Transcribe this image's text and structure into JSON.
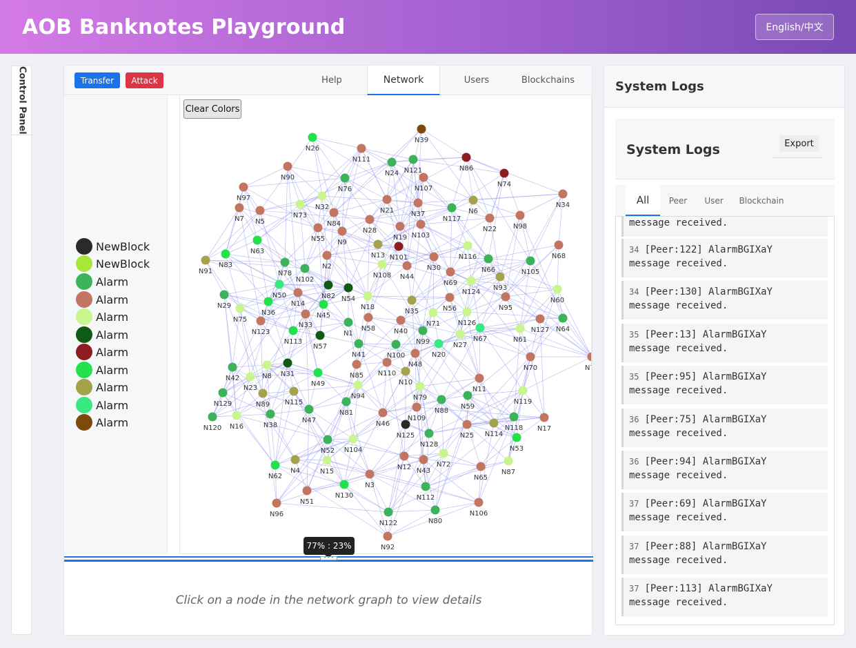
{
  "header": {
    "title": "AOB Banknotes Playground",
    "language_button": "English/中文"
  },
  "side_panel": {
    "label": "Control Panel"
  },
  "toolbar": {
    "transfer_label": "Transfer",
    "attack_label": "Attack"
  },
  "tabs": [
    "Help",
    "Network",
    "Users",
    "Blockchains"
  ],
  "active_tab": "Network",
  "graph": {
    "clear_colors_label": "Clear Colors"
  },
  "legend": [
    {
      "label": "NewBlock",
      "color": "#2a2a2a"
    },
    {
      "label": "NewBlock",
      "color": "#a8e63c"
    },
    {
      "label": "Alarm",
      "color": "#3cb35a"
    },
    {
      "label": "Alarm",
      "color": "#c27560"
    },
    {
      "label": "Alarm",
      "color": "#c8f58c"
    },
    {
      "label": "Alarm",
      "color": "#0f5a14"
    },
    {
      "label": "Alarm",
      "color": "#8e1d22"
    },
    {
      "label": "Alarm",
      "color": "#22e14a"
    },
    {
      "label": "Alarm",
      "color": "#a4a24a"
    },
    {
      "label": "Alarm",
      "color": "#38e883"
    },
    {
      "label": "Alarm",
      "color": "#7b4a0c"
    }
  ],
  "splitter": {
    "ratio": "77% : 23%"
  },
  "details": {
    "hint": "Click on a node in the network graph to view details"
  },
  "logs": {
    "card_title": "System Logs",
    "inner_title": "System Logs",
    "export_label": "Export",
    "tabs": [
      "All",
      "Peer",
      "User",
      "Blockchain"
    ],
    "active_tab": "All",
    "partial_entry": "message received.",
    "entries": [
      {
        "time": "34",
        "text": "[Peer:122] AlarmBGIXaY",
        "text2": "message received."
      },
      {
        "time": "34",
        "text": "[Peer:130] AlarmBGIXaY",
        "text2": "message received."
      },
      {
        "time": "35",
        "text": "[Peer:13] AlarmBGIXaY",
        "text2": "message received."
      },
      {
        "time": "35",
        "text": "[Peer:95] AlarmBGIXaY",
        "text2": "message received."
      },
      {
        "time": "36",
        "text": "[Peer:75] AlarmBGIXaY",
        "text2": "message received."
      },
      {
        "time": "36",
        "text": "[Peer:94] AlarmBGIXaY",
        "text2": "message received."
      },
      {
        "time": "37",
        "text": "[Peer:69] AlarmBGIXaY",
        "text2": "message received."
      },
      {
        "time": "37",
        "text": "[Peer:88] AlarmBGIXaY",
        "text2": "message received."
      },
      {
        "time": "37",
        "text": "[Peer:113] AlarmBGIXaY",
        "text2": "message received."
      }
    ]
  },
  "network_nodes": [
    {
      "label": "N39",
      "color": "#7b4a0c"
    },
    {
      "label": "N26",
      "color": "#22e14a"
    },
    {
      "label": "N111",
      "color": "#c27560"
    },
    {
      "label": "N86",
      "color": "#8e1d22"
    },
    {
      "label": "N24",
      "color": "#3cb35a"
    },
    {
      "label": "N121",
      "color": "#3cb35a"
    },
    {
      "label": "N90",
      "color": "#c27560"
    },
    {
      "label": "N76",
      "color": "#3cb35a"
    },
    {
      "label": "N107",
      "color": "#c27560"
    },
    {
      "label": "N74",
      "color": "#8e1d22"
    },
    {
      "label": "N97",
      "color": "#c27560"
    },
    {
      "label": "N34",
      "color": "#c27560"
    },
    {
      "label": "N7",
      "color": "#c27560"
    },
    {
      "label": "N5",
      "color": "#c27560"
    },
    {
      "label": "N73",
      "color": "#c8f58c"
    },
    {
      "label": "N32",
      "color": "#c8f58c"
    },
    {
      "label": "N84",
      "color": "#c27560"
    },
    {
      "label": "N21",
      "color": "#c27560"
    },
    {
      "label": "N37",
      "color": "#c27560"
    },
    {
      "label": "N117",
      "color": "#3cb35a"
    },
    {
      "label": "N6",
      "color": "#a4a24a"
    },
    {
      "label": "N22",
      "color": "#c27560"
    },
    {
      "label": "N98",
      "color": "#c27560"
    },
    {
      "label": "N55",
      "color": "#c27560"
    },
    {
      "label": "N28",
      "color": "#c27560"
    },
    {
      "label": "N9",
      "color": "#c27560"
    },
    {
      "label": "N19",
      "color": "#c27560"
    },
    {
      "label": "N103",
      "color": "#c27560"
    },
    {
      "label": "N63",
      "color": "#22e14a"
    },
    {
      "label": "N83",
      "color": "#22e14a"
    },
    {
      "label": "N13",
      "color": "#a4a24a"
    },
    {
      "label": "N101",
      "color": "#8e1d22"
    },
    {
      "label": "N116",
      "color": "#c8f58c"
    },
    {
      "label": "N68",
      "color": "#c27560"
    },
    {
      "label": "N91",
      "color": "#a4a24a"
    },
    {
      "label": "N78",
      "color": "#3cb35a"
    },
    {
      "label": "N102",
      "color": "#3cb35a"
    },
    {
      "label": "N2",
      "color": "#c27560"
    },
    {
      "label": "N108",
      "color": "#c8f58c"
    },
    {
      "label": "N44",
      "color": "#c27560"
    },
    {
      "label": "N30",
      "color": "#c27560"
    },
    {
      "label": "N66",
      "color": "#3cb35a"
    },
    {
      "label": "N105",
      "color": "#3cb35a"
    },
    {
      "label": "N69",
      "color": "#c27560"
    },
    {
      "label": "N93",
      "color": "#a4a24a"
    },
    {
      "label": "N50",
      "color": "#38e883"
    },
    {
      "label": "N82",
      "color": "#0f5a14"
    },
    {
      "label": "N54",
      "color": "#0f5a14"
    },
    {
      "label": "N124",
      "color": "#c8f58c"
    },
    {
      "label": "N29",
      "color": "#3cb35a"
    },
    {
      "label": "N14",
      "color": "#c27560"
    },
    {
      "label": "N18",
      "color": "#c8f58c"
    },
    {
      "label": "N35",
      "color": "#a4a24a"
    },
    {
      "label": "N95",
      "color": "#c27560"
    },
    {
      "label": "N60",
      "color": "#c8f58c"
    },
    {
      "label": "N75",
      "color": "#c8f58c"
    },
    {
      "label": "N36",
      "color": "#22e14a"
    },
    {
      "label": "N45",
      "color": "#22e14a"
    },
    {
      "label": "N56",
      "color": "#c27560"
    },
    {
      "label": "N33",
      "color": "#c27560"
    },
    {
      "label": "N71",
      "color": "#c8f58c"
    },
    {
      "label": "N126",
      "color": "#c8f58c"
    },
    {
      "label": "N123",
      "color": "#c27560"
    },
    {
      "label": "N1",
      "color": "#3cb35a"
    },
    {
      "label": "N58",
      "color": "#c27560"
    },
    {
      "label": "N40",
      "color": "#c27560"
    },
    {
      "label": "N127",
      "color": "#c27560"
    },
    {
      "label": "N64",
      "color": "#3cb35a"
    },
    {
      "label": "N113",
      "color": "#22e14a"
    },
    {
      "label": "N57",
      "color": "#0f5a14"
    },
    {
      "label": "N99",
      "color": "#3cb35a"
    },
    {
      "label": "N27",
      "color": "#c8f58c"
    },
    {
      "label": "N67",
      "color": "#38e883"
    },
    {
      "label": "N61",
      "color": "#c8f58c"
    },
    {
      "label": "N41",
      "color": "#3cb35a"
    },
    {
      "label": "N100",
      "color": "#3cb35a"
    },
    {
      "label": "N20",
      "color": "#38e883"
    },
    {
      "label": "N42",
      "color": "#3cb35a"
    },
    {
      "label": "N8",
      "color": "#c8f58c"
    },
    {
      "label": "N31",
      "color": "#0f5a14"
    },
    {
      "label": "N85",
      "color": "#c27560"
    },
    {
      "label": "N110",
      "color": "#c27560"
    },
    {
      "label": "N48",
      "color": "#c27560"
    },
    {
      "label": "N70",
      "color": "#c27560"
    },
    {
      "label": "N23",
      "color": "#c8f58c"
    },
    {
      "label": "N49",
      "color": "#22e14a"
    },
    {
      "label": "N10",
      "color": "#a4a24a"
    },
    {
      "label": "N11",
      "color": "#c27560"
    },
    {
      "label": "N129",
      "color": "#3cb35a"
    },
    {
      "label": "N89",
      "color": "#a4a24a"
    },
    {
      "label": "N115",
      "color": "#a4a24a"
    },
    {
      "label": "N94",
      "color": "#c8f58c"
    },
    {
      "label": "N79",
      "color": "#c8f58c"
    },
    {
      "label": "N59",
      "color": "#3cb35a"
    },
    {
      "label": "N119",
      "color": "#c8f58c"
    },
    {
      "label": "N120",
      "color": "#3cb35a"
    },
    {
      "label": "N16",
      "color": "#c8f58c"
    },
    {
      "label": "N38",
      "color": "#3cb35a"
    },
    {
      "label": "N47",
      "color": "#3cb35a"
    },
    {
      "label": "N81",
      "color": "#3cb35a"
    },
    {
      "label": "N46",
      "color": "#c27560"
    },
    {
      "label": "N109",
      "color": "#c27560"
    },
    {
      "label": "N88",
      "color": "#3cb35a"
    },
    {
      "label": "N118",
      "color": "#3cb35a"
    },
    {
      "label": "N17",
      "color": "#c27560"
    },
    {
      "label": "N125",
      "color": "#2a2a2a"
    },
    {
      "label": "N25",
      "color": "#c27560"
    },
    {
      "label": "N114",
      "color": "#a4a24a"
    },
    {
      "label": "N128",
      "color": "#3cb35a"
    },
    {
      "label": "N53",
      "color": "#22e14a"
    },
    {
      "label": "N52",
      "color": "#3cb35a"
    },
    {
      "label": "N104",
      "color": "#c8f58c"
    },
    {
      "label": "N4",
      "color": "#a4a24a"
    },
    {
      "label": "N15",
      "color": "#c8f58c"
    },
    {
      "label": "N12",
      "color": "#c27560"
    },
    {
      "label": "N43",
      "color": "#c27560"
    },
    {
      "label": "N72",
      "color": "#c8f58c"
    },
    {
      "label": "N87",
      "color": "#c8f58c"
    },
    {
      "label": "N62",
      "color": "#22e14a"
    },
    {
      "label": "N65",
      "color": "#c27560"
    },
    {
      "label": "N3",
      "color": "#c27560"
    },
    {
      "label": "N130",
      "color": "#22e14a"
    },
    {
      "label": "N51",
      "color": "#c27560"
    },
    {
      "label": "N112",
      "color": "#3cb35a"
    },
    {
      "label": "N96",
      "color": "#c27560"
    },
    {
      "label": "N80",
      "color": "#3cb35a"
    },
    {
      "label": "N106",
      "color": "#c27560"
    },
    {
      "label": "N122",
      "color": "#3cb35a"
    },
    {
      "label": "N92",
      "color": "#c27560"
    },
    {
      "label": "N77",
      "color": "#c27560"
    }
  ]
}
